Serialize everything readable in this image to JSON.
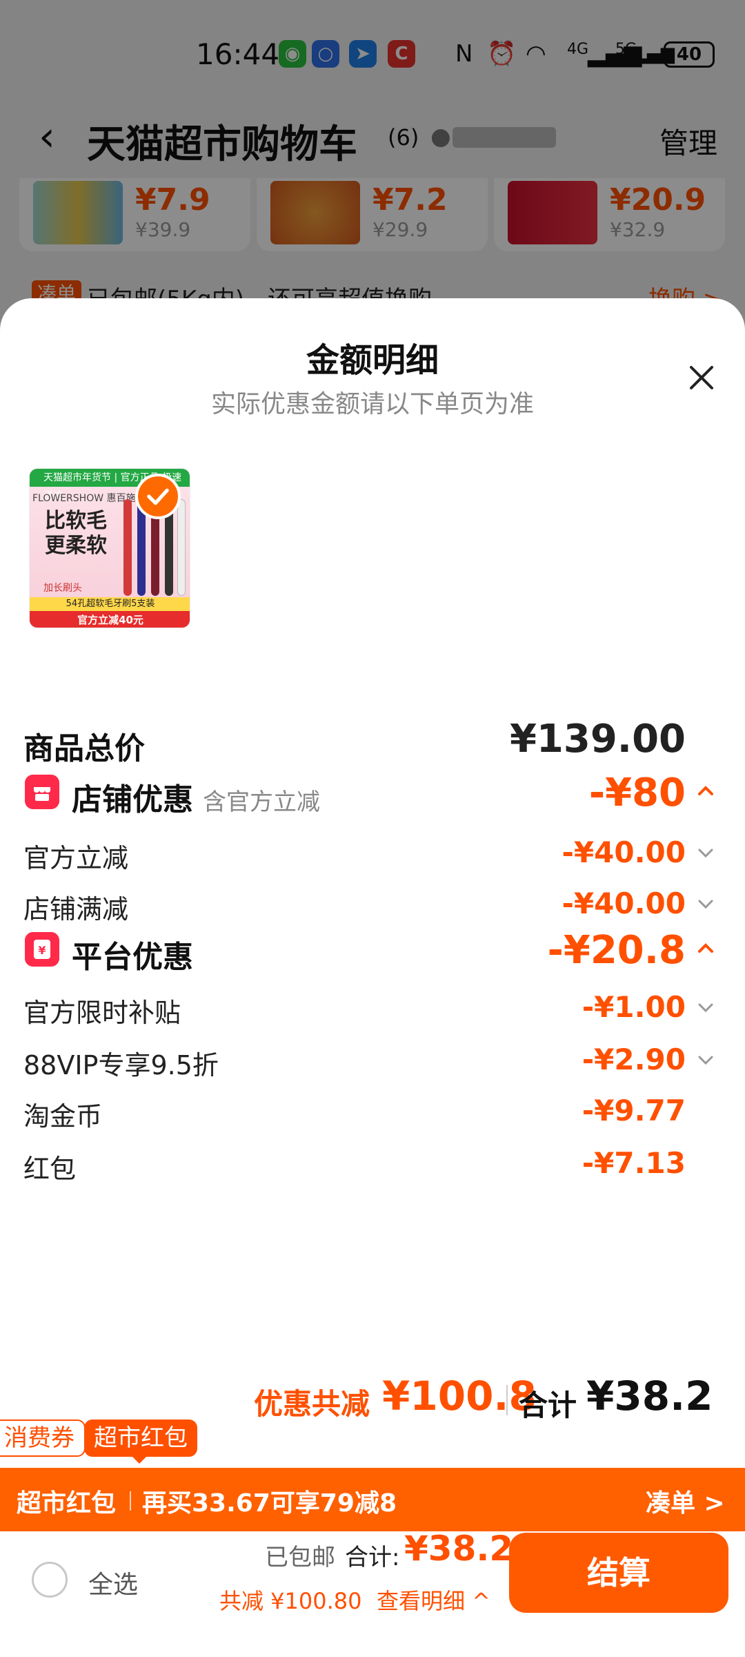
{
  "status_bar": {
    "time": "16:44",
    "battery": "40",
    "network_4g": "4G",
    "network_5g": "5G",
    "icons": [
      "wechat-icon",
      "app-icon",
      "browser-icon",
      "app-c-icon",
      "nfc-icon",
      "alarm-icon",
      "wifi-icon",
      "signal-4g-icon",
      "signal-5g-icon",
      "battery-icon"
    ]
  },
  "nav": {
    "title": "天猫超市购物车",
    "count": "(6)",
    "manage": "管理"
  },
  "product_strip": [
    {
      "price": "¥7.9",
      "original": "¥39.9"
    },
    {
      "price": "¥7.2",
      "original": "¥29.9"
    },
    {
      "price": "¥20.9",
      "original": "¥32.9"
    }
  ],
  "promo": {
    "tag": "凑单",
    "text": "已包邮(5Kg内)，还可享超值换购",
    "link": "换购 >"
  },
  "sheet": {
    "title": "金额明细",
    "subtitle": "实际优惠金额请以下单页为准",
    "product_image": {
      "banner": "天猫超市年货节 | 官方正品 极速送达",
      "brand": "FLOWERSHOW 惠百施",
      "headline_line1": "比软毛",
      "headline_line2": "更柔软",
      "note": "加长刷头",
      "bottom1": "54孔超软毛牙刷5支装",
      "bottom2": "官方立减40元"
    },
    "total_label": "商品总价",
    "total_value": "¥139.00",
    "shop_discount": {
      "label": "店铺优惠",
      "hint": "含官方立减",
      "value": "-¥80",
      "items": [
        {
          "label": "官方立减",
          "value": "-¥40.00"
        },
        {
          "label": "店铺满减",
          "value": "-¥40.00"
        }
      ]
    },
    "platform_discount": {
      "label": "平台优惠",
      "value": "-¥20.8",
      "items": [
        {
          "label": "官方限时补贴",
          "value": "-¥1.00"
        },
        {
          "label": "88VIP专享9.5折",
          "value": "-¥2.90"
        },
        {
          "label": "淘金币",
          "value": "-¥9.77"
        },
        {
          "label": "红包",
          "value": "-¥7.13"
        }
      ]
    },
    "summary": {
      "saved_label": "优惠共减",
      "saved_value": "¥100.8",
      "total_label": "合计",
      "total_value": "¥38.2"
    }
  },
  "coupon_tags": [
    "消费券",
    "超市红包"
  ],
  "redpack_bar": {
    "label": "超市红包",
    "text": "再买33.67可享79减8",
    "link": "凑单 >"
  },
  "checkout": {
    "select_all": "全选",
    "shipping": "已包邮",
    "total_label": "合计:",
    "total_amount": "¥38.2",
    "saved": "共减 ¥100.80",
    "detail": "查看明细 ^",
    "button": "结算"
  },
  "colors": {
    "accent": "#ff5000",
    "button": "#ff5a00",
    "section_icon": "#ff2a4a"
  }
}
